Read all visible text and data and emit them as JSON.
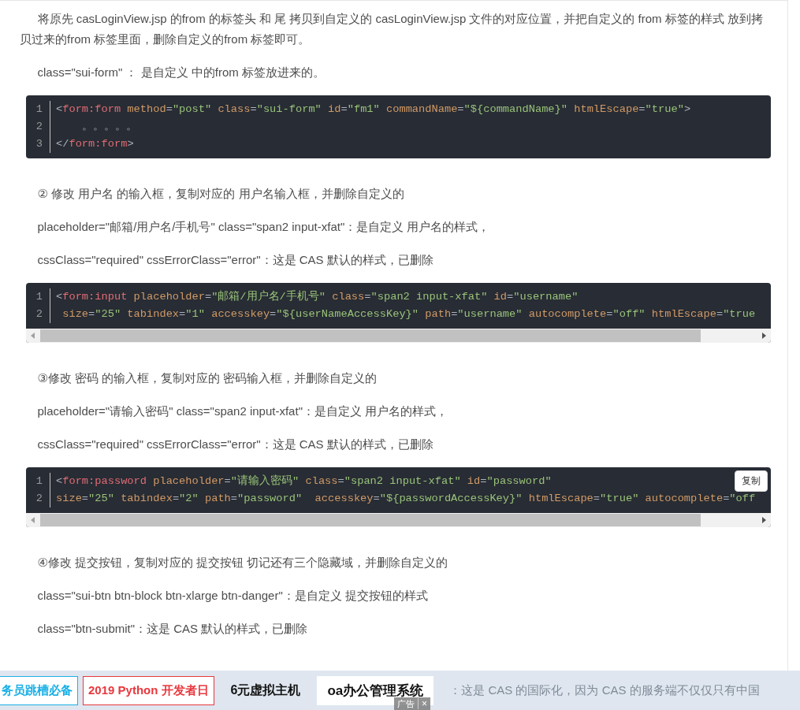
{
  "article": [
    {
      "kind": "para",
      "text": "将原先 casLoginView.jsp 的from 的标签头 和 尾 拷贝到自定义的 casLoginView.jsp 文件的对应位置，并把自定义的 from 标签的样式 放到拷贝过来的from 标签里面，删除自定义的from 标签即可。"
    },
    {
      "kind": "para",
      "text": "class=\"sui-form\" ： 是自定义 中的from 标签放进来的。"
    },
    {
      "kind": "code",
      "scroll": false,
      "lines": [
        {
          "number": "1",
          "tokens": [
            {
              "kind": "punct",
              "text": "<"
            },
            {
              "kind": "tag",
              "text": "form:form"
            },
            {
              "kind": "attr",
              "text": " method"
            },
            {
              "kind": "punct",
              "text": "="
            },
            {
              "kind": "str",
              "text": "\"post\""
            },
            {
              "kind": "attr",
              "text": " class"
            },
            {
              "kind": "punct",
              "text": "="
            },
            {
              "kind": "str",
              "text": "\"sui-form\""
            },
            {
              "kind": "attr",
              "text": " id"
            },
            {
              "kind": "punct",
              "text": "="
            },
            {
              "kind": "str",
              "text": "\"fm1\""
            },
            {
              "kind": "attr",
              "text": " commandName"
            },
            {
              "kind": "punct",
              "text": "="
            },
            {
              "kind": "str",
              "text": "\"${commandName}\""
            },
            {
              "kind": "attr",
              "text": " htmlEscape"
            },
            {
              "kind": "punct",
              "text": "="
            },
            {
              "kind": "str",
              "text": "\"true\""
            },
            {
              "kind": "punct",
              "text": ">"
            }
          ]
        },
        {
          "number": "2",
          "tokens": [
            {
              "kind": "plain",
              "text": "    。。。。。"
            }
          ]
        },
        {
          "number": "3",
          "tokens": [
            {
              "kind": "punct",
              "text": "</"
            },
            {
              "kind": "tag",
              "text": "form:form"
            },
            {
              "kind": "punct",
              "text": ">"
            }
          ]
        }
      ]
    },
    {
      "kind": "para",
      "text": "② 修改 用户名 的输入框，复制对应的 用户名输入框，并删除自定义的"
    },
    {
      "kind": "para",
      "text": "placeholder=\"邮箱/用户名/手机号\" class=\"span2 input-xfat\"：是自定义 用户名的样式，"
    },
    {
      "kind": "para",
      "text": "cssClass=\"required\" cssErrorClass=\"error\"：这是 CAS 默认的样式，已删除"
    },
    {
      "kind": "code",
      "scroll": true,
      "lines": [
        {
          "number": "1",
          "tokens": [
            {
              "kind": "punct",
              "text": "<"
            },
            {
              "kind": "tag",
              "text": "form:input"
            },
            {
              "kind": "attr",
              "text": " placeholder"
            },
            {
              "kind": "punct",
              "text": "="
            },
            {
              "kind": "str",
              "text": "\"邮箱/用户名/手机号\""
            },
            {
              "kind": "attr",
              "text": " class"
            },
            {
              "kind": "punct",
              "text": "="
            },
            {
              "kind": "str",
              "text": "\"span2 input-xfat\""
            },
            {
              "kind": "attr",
              "text": " id"
            },
            {
              "kind": "punct",
              "text": "="
            },
            {
              "kind": "str",
              "text": "\"username\""
            }
          ]
        },
        {
          "number": "2",
          "tokens": [
            {
              "kind": "attr",
              "text": " size"
            },
            {
              "kind": "punct",
              "text": "="
            },
            {
              "kind": "str",
              "text": "\"25\""
            },
            {
              "kind": "attr",
              "text": " tabindex"
            },
            {
              "kind": "punct",
              "text": "="
            },
            {
              "kind": "str",
              "text": "\"1\""
            },
            {
              "kind": "attr",
              "text": " accesskey"
            },
            {
              "kind": "punct",
              "text": "="
            },
            {
              "kind": "str",
              "text": "\"${userNameAccessKey}\""
            },
            {
              "kind": "attr",
              "text": " path"
            },
            {
              "kind": "punct",
              "text": "="
            },
            {
              "kind": "str",
              "text": "\"username\""
            },
            {
              "kind": "attr",
              "text": " autocomplete"
            },
            {
              "kind": "punct",
              "text": "="
            },
            {
              "kind": "str",
              "text": "\"off\""
            },
            {
              "kind": "attr",
              "text": " htmlEscape"
            },
            {
              "kind": "punct",
              "text": "="
            },
            {
              "kind": "str",
              "text": "\"true"
            }
          ]
        }
      ]
    },
    {
      "kind": "para",
      "text": "③修改 密码 的输入框，复制对应的 密码输入框，并删除自定义的"
    },
    {
      "kind": "para",
      "text": "placeholder=\"请输入密码\" class=\"span2 input-xfat\"：是自定义 用户名的样式，"
    },
    {
      "kind": "para",
      "text": "cssClass=\"required\" cssErrorClass=\"error\"：这是 CAS 默认的样式，已删除"
    },
    {
      "kind": "code",
      "scroll": true,
      "copy_button": "复制",
      "lines": [
        {
          "number": "1",
          "tokens": [
            {
              "kind": "punct",
              "text": "<"
            },
            {
              "kind": "tag",
              "text": "form:password"
            },
            {
              "kind": "attr",
              "text": " placeholder"
            },
            {
              "kind": "punct",
              "text": "="
            },
            {
              "kind": "str",
              "text": "\"请输入密码\""
            },
            {
              "kind": "attr",
              "text": " class"
            },
            {
              "kind": "punct",
              "text": "="
            },
            {
              "kind": "str",
              "text": "\"span2 input-xfat\""
            },
            {
              "kind": "attr",
              "text": " id"
            },
            {
              "kind": "punct",
              "text": "="
            },
            {
              "kind": "str",
              "text": "\"password\""
            }
          ]
        },
        {
          "number": "2",
          "tokens": [
            {
              "kind": "attr",
              "text": "size"
            },
            {
              "kind": "punct",
              "text": "="
            },
            {
              "kind": "str",
              "text": "\"25\""
            },
            {
              "kind": "attr",
              "text": " tabindex"
            },
            {
              "kind": "punct",
              "text": "="
            },
            {
              "kind": "str",
              "text": "\"2\""
            },
            {
              "kind": "attr",
              "text": " path"
            },
            {
              "kind": "punct",
              "text": "="
            },
            {
              "kind": "str",
              "text": "\"password\""
            },
            {
              "kind": "attr",
              "text": "  accesskey"
            },
            {
              "kind": "punct",
              "text": "="
            },
            {
              "kind": "str",
              "text": "\"${passwordAccessKey}\""
            },
            {
              "kind": "attr",
              "text": " htmlEscape"
            },
            {
              "kind": "punct",
              "text": "="
            },
            {
              "kind": "str",
              "text": "\"true\""
            },
            {
              "kind": "attr",
              "text": " autocomplete"
            },
            {
              "kind": "punct",
              "text": "="
            },
            {
              "kind": "str",
              "text": "\"off"
            }
          ]
        }
      ]
    },
    {
      "kind": "para",
      "text": "④修改 提交按钮，复制对应的 提交按钮 切记还有三个隐藏域，并删除自定义的"
    },
    {
      "kind": "para",
      "text": "class=\"sui-btn btn-block btn-xlarge btn-danger\"：是自定义 提交按钮的样式"
    },
    {
      "kind": "para",
      "text": "class=\"btn-submit\"：这是 CAS 默认的样式，已删除"
    }
  ],
  "ad_bar": {
    "links": [
      {
        "text": "务员跳槽必备",
        "kind": "boxed",
        "color": "#1ab0e6"
      },
      {
        "text": "2019 Python 开发者日",
        "kind": "boxed",
        "color": "#e8383d"
      },
      {
        "text": "6元虚拟主机",
        "kind": "plain",
        "color": "#111111"
      },
      {
        "text": "oa办公管理系统",
        "kind": "filled",
        "color": "#111111"
      }
    ],
    "ad_label": "广告",
    "close": "×",
    "behind_text": "：这是 CAS 的国际化，因为 CAS 的服务端不仅仅只有中国"
  }
}
